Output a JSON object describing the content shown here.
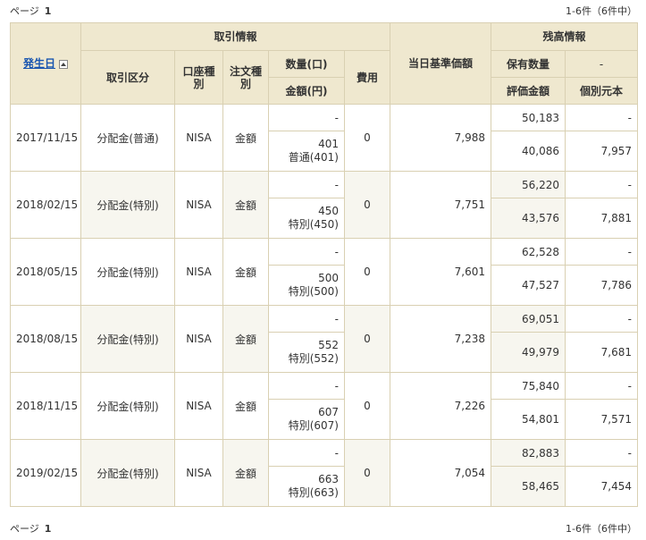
{
  "pager": {
    "page_label": "ページ",
    "page_number": "1",
    "count_text": "1-6件（6件中）"
  },
  "header": {
    "date_col": "発生日",
    "group_trade": "取引情報",
    "trade_type": "取引区分",
    "account_type": "口座種別",
    "order_type": "注文種別",
    "quantity": "数量(口)",
    "amount": "金額(円)",
    "fee": "費用",
    "nav": "当日基準価額",
    "group_balance": "残高情報",
    "holding_qty": "保有数量",
    "holding_qty_sub": "-",
    "valuation": "評価金額",
    "cost": "個別元本"
  },
  "rows": [
    {
      "date": "2017/11/15",
      "type": "分配金(普通)",
      "account": "NISA",
      "order": "金額",
      "qty": "-",
      "amount": "401",
      "amount_detail": "普通(401)",
      "fee": "0",
      "nav": "7,988",
      "holding": "50,183",
      "holding_sub": "-",
      "valuation": "40,086",
      "cost": "7,957"
    },
    {
      "date": "2018/02/15",
      "type": "分配金(特別)",
      "account": "NISA",
      "order": "金額",
      "qty": "-",
      "amount": "450",
      "amount_detail": "特別(450)",
      "fee": "0",
      "nav": "7,751",
      "holding": "56,220",
      "holding_sub": "-",
      "valuation": "43,576",
      "cost": "7,881"
    },
    {
      "date": "2018/05/15",
      "type": "分配金(特別)",
      "account": "NISA",
      "order": "金額",
      "qty": "-",
      "amount": "500",
      "amount_detail": "特別(500)",
      "fee": "0",
      "nav": "7,601",
      "holding": "62,528",
      "holding_sub": "-",
      "valuation": "47,527",
      "cost": "7,786"
    },
    {
      "date": "2018/08/15",
      "type": "分配金(特別)",
      "account": "NISA",
      "order": "金額",
      "qty": "-",
      "amount": "552",
      "amount_detail": "特別(552)",
      "fee": "0",
      "nav": "7,238",
      "holding": "69,051",
      "holding_sub": "-",
      "valuation": "49,979",
      "cost": "7,681"
    },
    {
      "date": "2018/11/15",
      "type": "分配金(特別)",
      "account": "NISA",
      "order": "金額",
      "qty": "-",
      "amount": "607",
      "amount_detail": "特別(607)",
      "fee": "0",
      "nav": "7,226",
      "holding": "75,840",
      "holding_sub": "-",
      "valuation": "54,801",
      "cost": "7,571"
    },
    {
      "date": "2019/02/15",
      "type": "分配金(特別)",
      "account": "NISA",
      "order": "金額",
      "qty": "-",
      "amount": "663",
      "amount_detail": "特別(663)",
      "fee": "0",
      "nav": "7,054",
      "holding": "82,883",
      "holding_sub": "-",
      "valuation": "58,465",
      "cost": "7,454"
    }
  ]
}
